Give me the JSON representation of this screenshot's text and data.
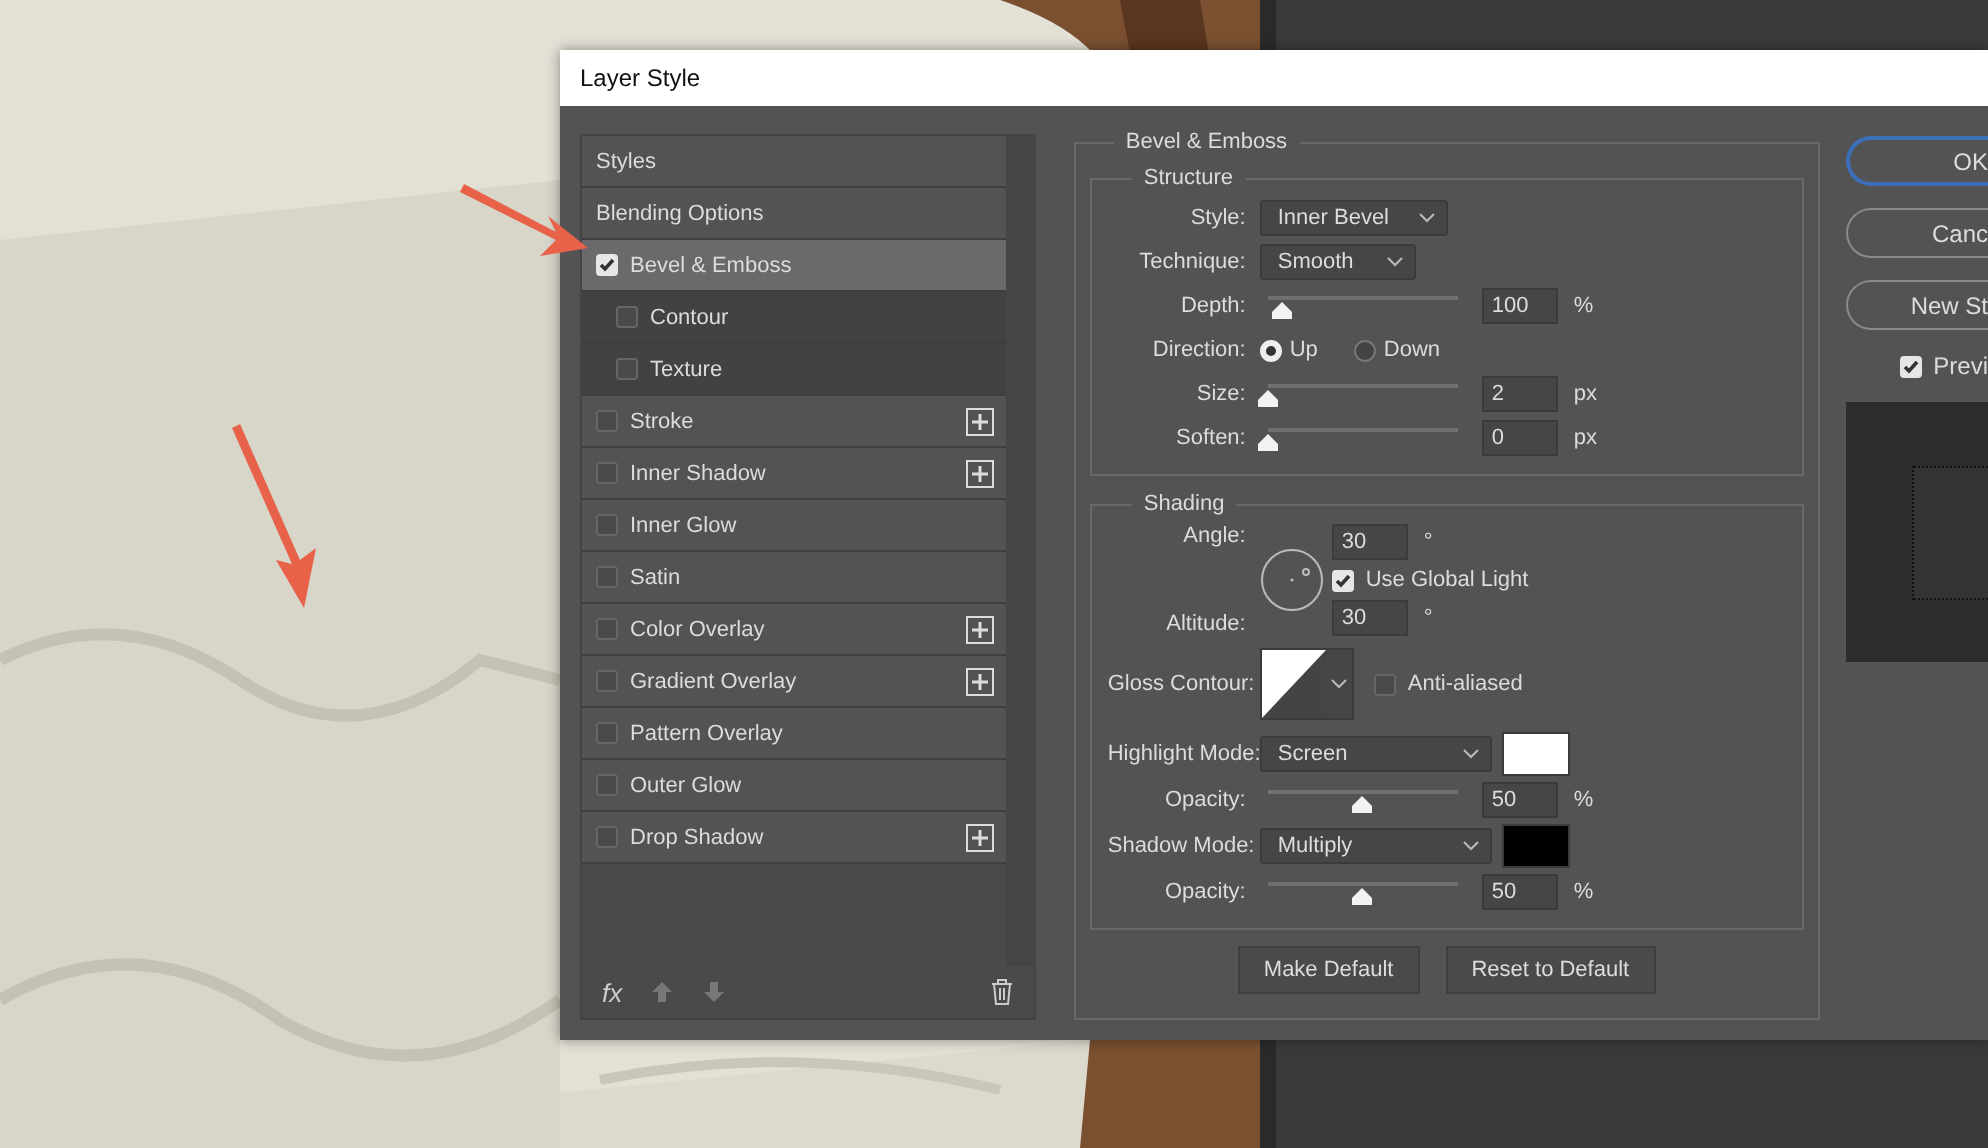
{
  "dialog": {
    "title": "Layer Style",
    "styles_list": [
      {
        "kind": "header",
        "label": "Styles",
        "selected": false
      },
      {
        "kind": "header",
        "label": "Blending Options",
        "selected": false
      },
      {
        "kind": "effect",
        "label": "Bevel & Emboss",
        "checked": true,
        "selected": true,
        "add_button": false,
        "children": [
          {
            "kind": "effect",
            "label": "Contour",
            "checked": false,
            "selected": false,
            "add_button": false
          },
          {
            "kind": "effect",
            "label": "Texture",
            "checked": false,
            "selected": false,
            "add_button": false
          }
        ]
      },
      {
        "kind": "effect",
        "label": "Stroke",
        "checked": false,
        "selected": false,
        "add_button": true
      },
      {
        "kind": "effect",
        "label": "Inner Shadow",
        "checked": false,
        "selected": false,
        "add_button": true
      },
      {
        "kind": "effect",
        "label": "Inner Glow",
        "checked": false,
        "selected": false,
        "add_button": false
      },
      {
        "kind": "effect",
        "label": "Satin",
        "checked": false,
        "selected": false,
        "add_button": false
      },
      {
        "kind": "effect",
        "label": "Color Overlay",
        "checked": false,
        "selected": false,
        "add_button": true
      },
      {
        "kind": "effect",
        "label": "Gradient Overlay",
        "checked": false,
        "selected": false,
        "add_button": true
      },
      {
        "kind": "effect",
        "label": "Pattern Overlay",
        "checked": false,
        "selected": false,
        "add_button": false
      },
      {
        "kind": "effect",
        "label": "Outer Glow",
        "checked": false,
        "selected": false,
        "add_button": false
      },
      {
        "kind": "effect",
        "label": "Drop Shadow",
        "checked": false,
        "selected": false,
        "add_button": true
      }
    ],
    "list_footer": {
      "fx": "fx"
    },
    "bevel_emboss": {
      "title": "Bevel & Emboss",
      "structure": {
        "title": "Structure",
        "rows": [
          {
            "kind": "dropdown",
            "label": "Style:",
            "value": "Inner Bevel"
          },
          {
            "kind": "dropdown",
            "label": "Technique:",
            "value": "Smooth"
          },
          {
            "kind": "slider",
            "label": "Depth:",
            "level": 0.08,
            "value": "100",
            "unit": "%"
          },
          {
            "kind": "radio",
            "label": "Direction:",
            "options": [
              {
                "label": "Up",
                "selected": true
              },
              {
                "label": "Down",
                "selected": false
              }
            ]
          },
          {
            "kind": "slider",
            "label": "Size:",
            "level": 0.0,
            "value": "2",
            "unit": "px"
          },
          {
            "kind": "slider",
            "label": "Soften:",
            "level": 0.0,
            "value": "0",
            "unit": "px"
          }
        ]
      },
      "shading": {
        "title": "Shading",
        "angle": {
          "label": "Angle:",
          "value": "30",
          "unit": "°"
        },
        "use_global_light": {
          "label": "Use Global Light",
          "checked": true
        },
        "altitude": {
          "label": "Altitude:",
          "value": "30",
          "unit": "°"
        },
        "gloss_contour": {
          "label": "Gloss Contour:"
        },
        "anti_aliased": {
          "label": "Anti-aliased",
          "checked": false
        },
        "modes": [
          {
            "label": "Highlight Mode:",
            "value": "Screen",
            "color": "#ffffff",
            "opacity": {
              "label": "Opacity:",
              "level": 0.5,
              "value": "50",
              "unit": "%"
            }
          },
          {
            "label": "Shadow Mode:",
            "value": "Multiply",
            "color": "#000000",
            "opacity": {
              "label": "Opacity:",
              "level": 0.5,
              "value": "50",
              "unit": "%"
            }
          }
        ]
      },
      "buttons": [
        "Make Default",
        "Reset to Default"
      ]
    },
    "side_buttons": [
      {
        "label": "OK",
        "default": true
      },
      {
        "label": "Canc",
        "default": false
      },
      {
        "label": "New St",
        "default": false
      }
    ],
    "preview": {
      "label": "Previ",
      "checked": true
    }
  }
}
